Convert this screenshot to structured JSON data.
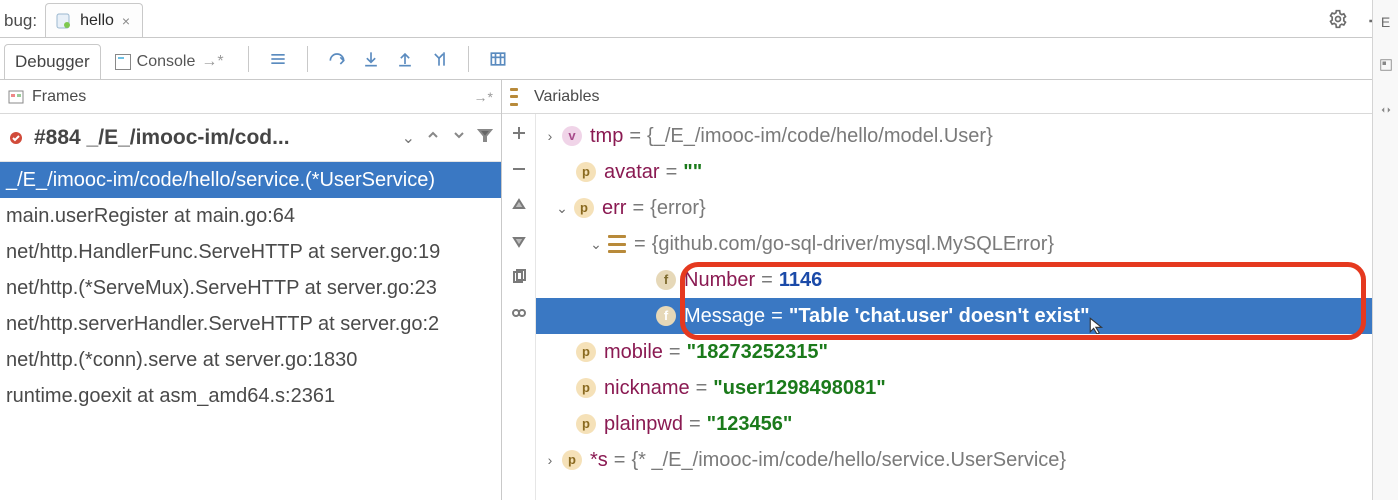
{
  "top": {
    "bug_label": "bug:",
    "tab_name": "hello",
    "right_rail_0": "E"
  },
  "debugger": {
    "tab_debugger": "Debugger",
    "tab_console": "Console"
  },
  "frames": {
    "title": "Frames",
    "dropdown": "#884 _/E_/imooc-im/cod...",
    "items": [
      "_/E_/imooc-im/code/hello/service.(*UserService)",
      "main.userRegister at main.go:64",
      "net/http.HandlerFunc.ServeHTTP at server.go:19",
      "net/http.(*ServeMux).ServeHTTP at server.go:23",
      "net/http.serverHandler.ServeHTTP at server.go:2",
      "net/http.(*conn).serve at server.go:1830",
      "runtime.goexit at asm_amd64.s:2361"
    ]
  },
  "variables": {
    "title": "Variables",
    "rows": {
      "tmp_name": "tmp",
      "tmp_val": "{_/E_/imooc-im/code/hello/model.User}",
      "avatar_name": "avatar",
      "avatar_val": "\"\"",
      "err_name": "err",
      "err_val": "{error}",
      "mysql_val": "{github.com/go-sql-driver/mysql.MySQLError}",
      "number_name": "Number",
      "number_val": "1146",
      "message_name": "Message",
      "message_val": "\"Table 'chat.user' doesn't exist\"",
      "mobile_name": "mobile",
      "mobile_val": "\"18273252315\"",
      "nickname_name": "nickname",
      "nickname_val": "\"user1298498081\"",
      "plainpwd_name": "plainpwd",
      "plainpwd_val": "\"123456\"",
      "s_name": "*s",
      "s_val": "{* _/E_/imooc-im/code/hello/service.UserService}"
    }
  }
}
